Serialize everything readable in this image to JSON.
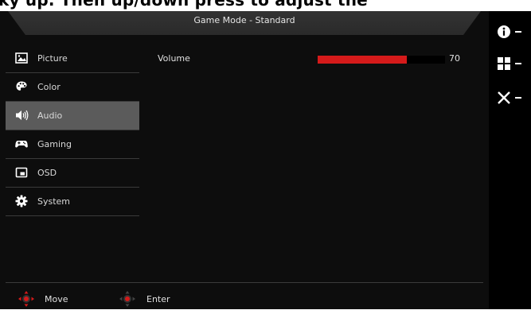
{
  "top_strip_text": "ky up. Then up/down press to adjust the",
  "header": {
    "title": "Game Mode - Standard"
  },
  "sidebar": {
    "items": [
      {
        "label": "Picture",
        "icon": "picture-icon",
        "active": false
      },
      {
        "label": "Color",
        "icon": "palette-icon",
        "active": false
      },
      {
        "label": "Audio",
        "icon": "speaker-icon",
        "active": true
      },
      {
        "label": "Gaming",
        "icon": "gamepad-icon",
        "active": false
      },
      {
        "label": "OSD",
        "icon": "osd-window-icon",
        "active": false
      },
      {
        "label": "System",
        "icon": "gear-icon",
        "active": false
      }
    ]
  },
  "content": {
    "volume": {
      "label": "Volume",
      "value": "70",
      "level_percent": 70
    }
  },
  "footer": {
    "move_label": "Move",
    "enter_label": "Enter"
  },
  "right_rail": {
    "buttons": [
      {
        "icon": "info-icon"
      },
      {
        "icon": "grid-icon"
      },
      {
        "icon": "close-icon"
      }
    ]
  },
  "colors": {
    "accent_red": "#d51a1a",
    "osd_background": "#0d0d0d",
    "active_item": "#5b5b5b"
  }
}
